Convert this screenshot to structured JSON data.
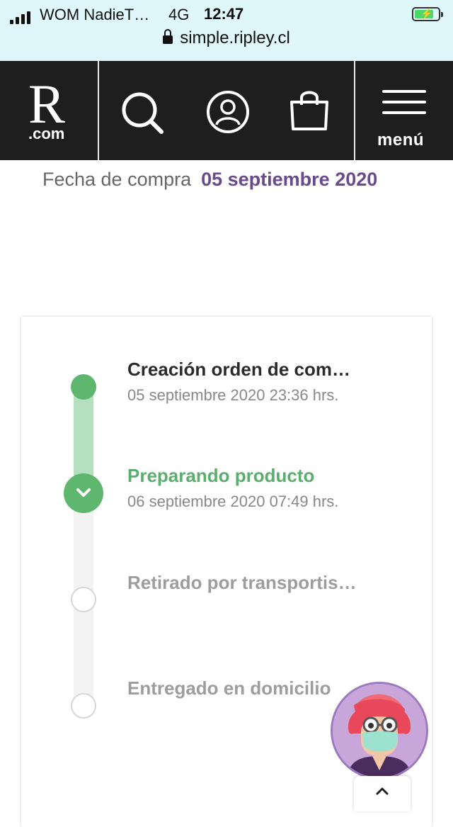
{
  "status_bar": {
    "carrier": "WOM NadieT…",
    "network": "4G",
    "time": "12:47",
    "url": "simple.ripley.cl"
  },
  "header": {
    "logo_letter": "R",
    "logo_suffix": ".com",
    "menu_label": "menú",
    "icons": [
      "search-icon",
      "user-icon",
      "shopping-bag-icon",
      "hamburger-menu-icon"
    ]
  },
  "purchase": {
    "date_label": "Fecha de compra",
    "date_value": "05 septiembre 2020"
  },
  "tracking": {
    "steps": [
      {
        "title": "Creación orden de com…",
        "date": "05 septiembre 2020 23:36 hrs.",
        "state": "done"
      },
      {
        "title": "Preparando producto",
        "date": "06 septiembre 2020 07:49 hrs.",
        "state": "current"
      },
      {
        "title": "Retirado por transportis…",
        "date": "",
        "state": "pending"
      },
      {
        "title": "Entregado en domicilio",
        "date": "",
        "state": "pending"
      }
    ]
  },
  "colors": {
    "header_bg": "#1e1e1e",
    "accent_purple": "#6a4a8c",
    "success_green": "#5fb66f",
    "track_done": "#b5e0bf",
    "status_bar_bg": "#dff7fb"
  }
}
